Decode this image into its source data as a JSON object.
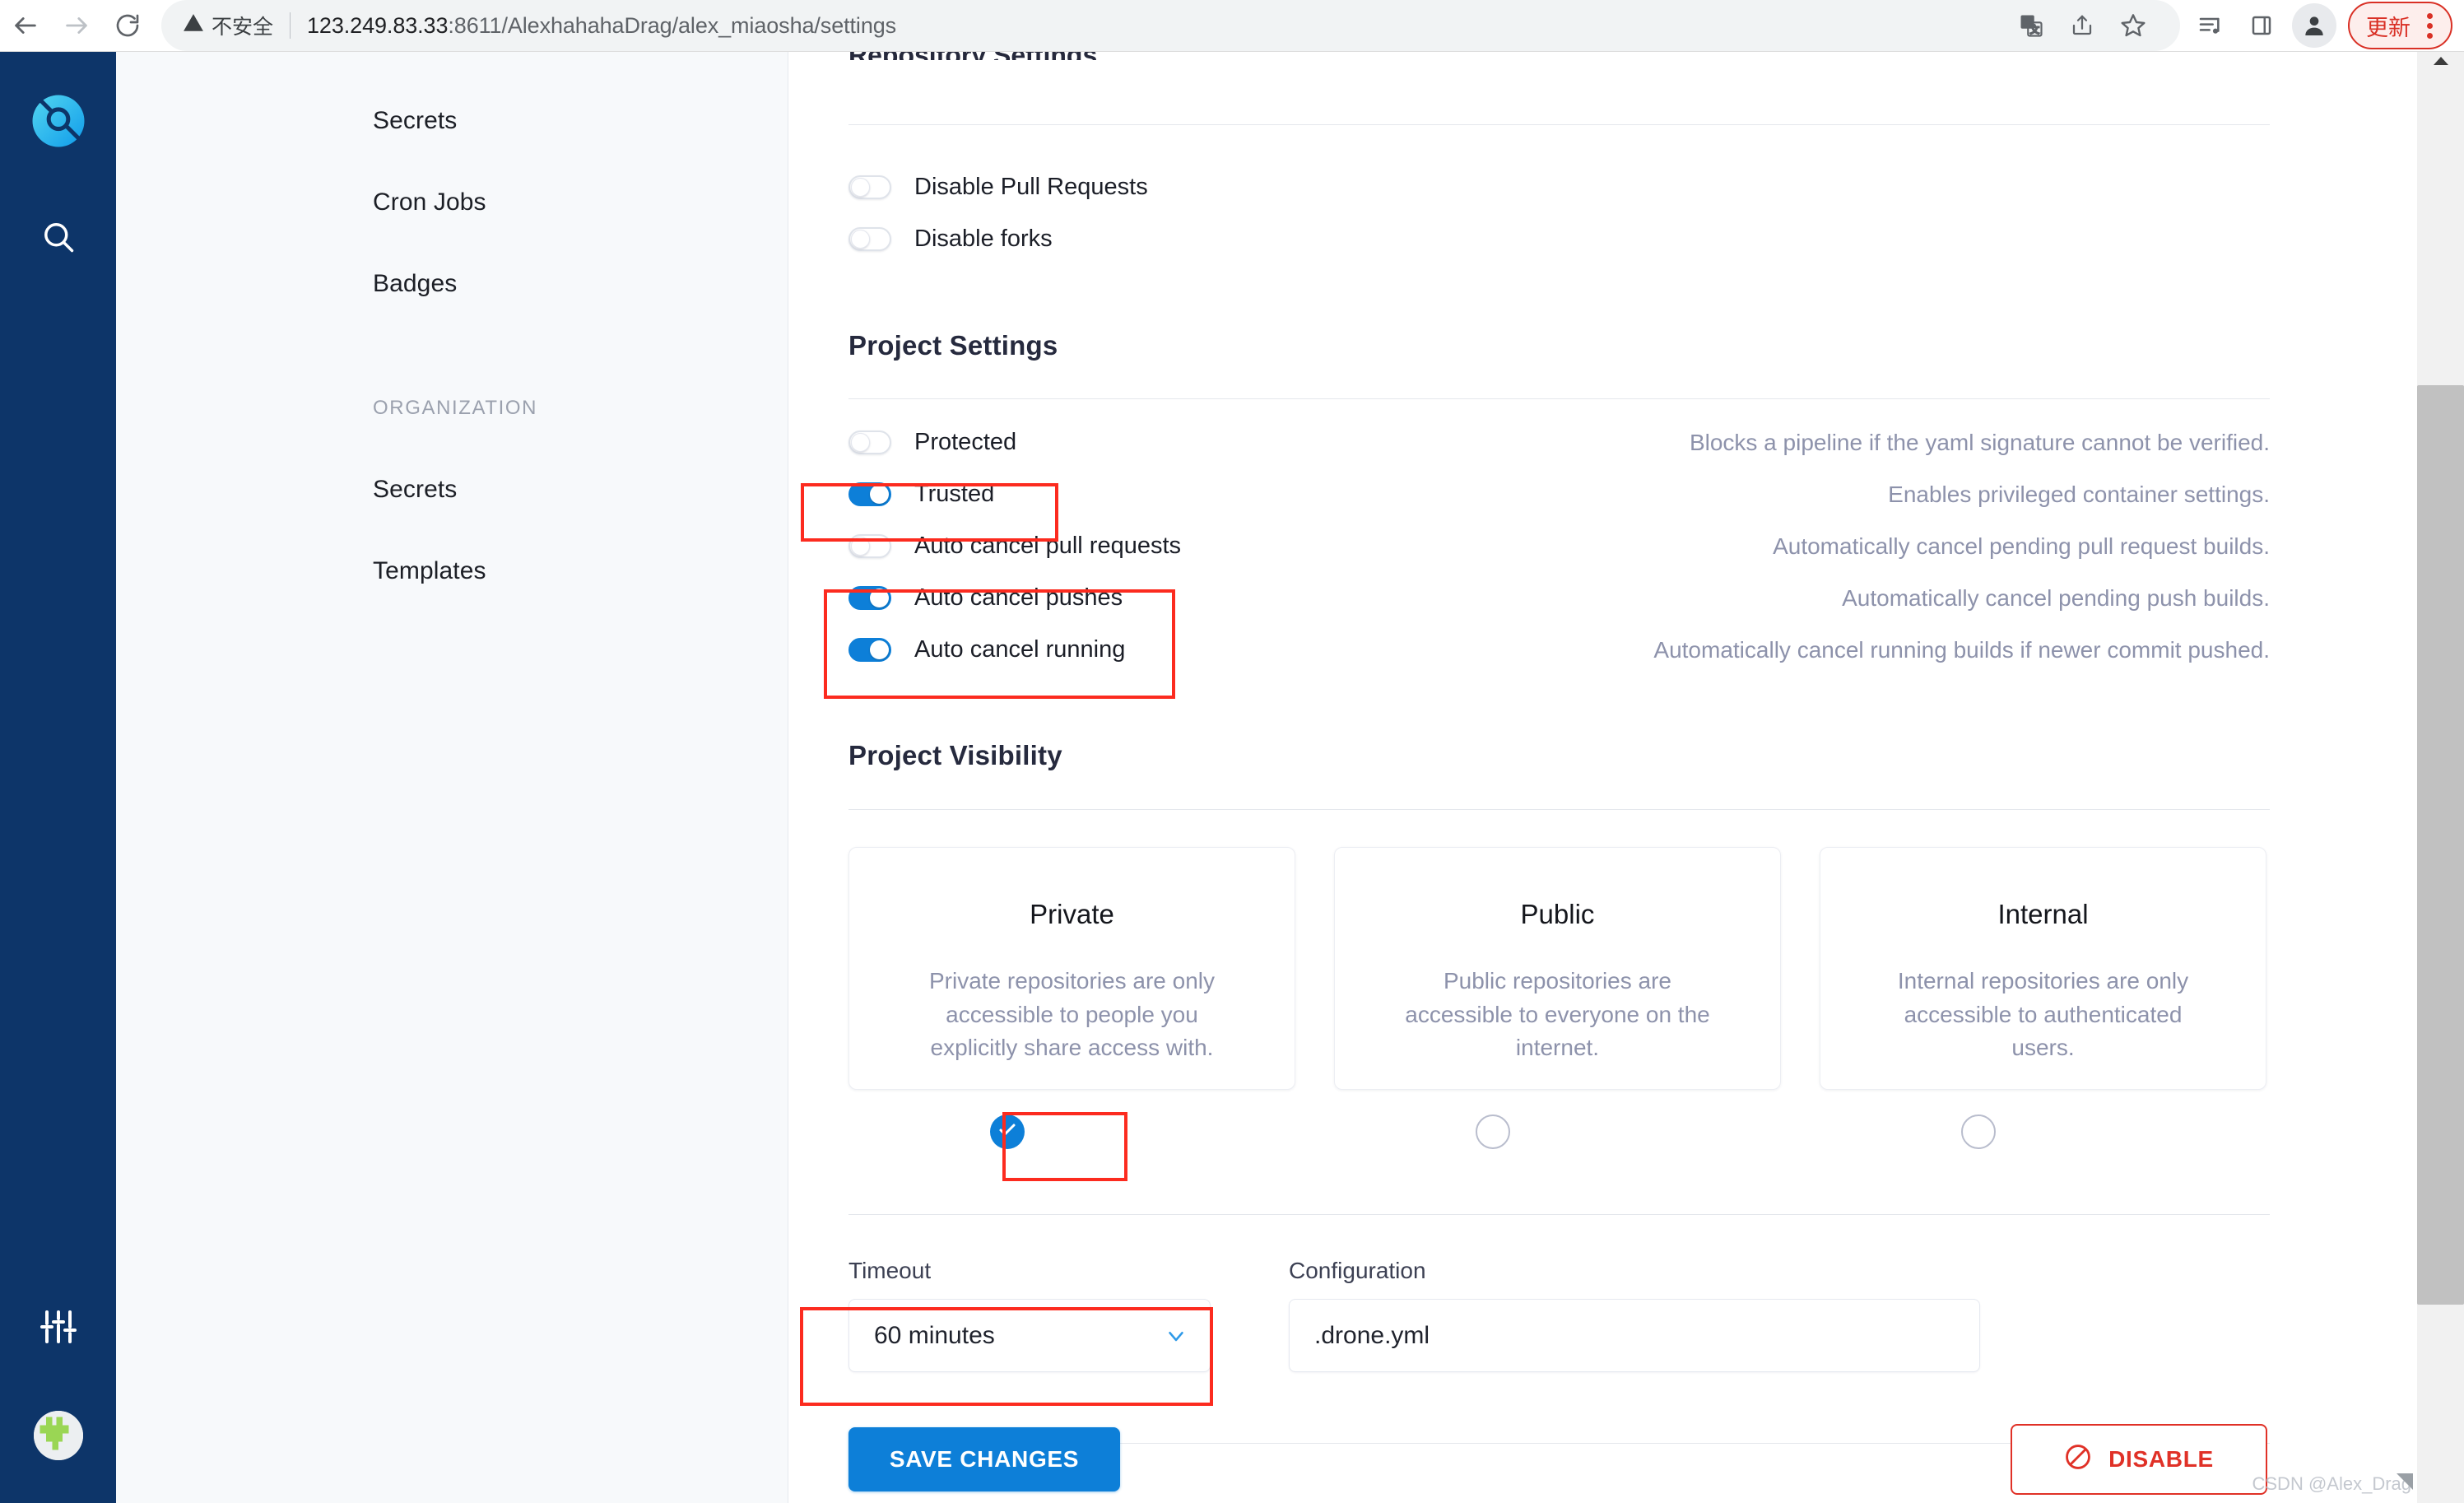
{
  "browser": {
    "back_icon": "back-arrow-icon",
    "forward_icon": "forward-arrow-icon",
    "reload_icon": "reload-icon",
    "security_icon": "warning-triangle-icon",
    "security_label": "不安全",
    "url_host": "123.249.83.33",
    "url_rest": ":8611/AlexhahahaDrag/alex_miaosha/settings",
    "actions": [
      {
        "name": "translate-icon"
      },
      {
        "name": "share-icon"
      },
      {
        "name": "bookmark-star-icon"
      }
    ],
    "toolbar_right": [
      {
        "name": "media-playlist-icon"
      },
      {
        "name": "side-panel-icon"
      }
    ],
    "avatar_icon": "profile-avatar-icon",
    "update_label": "更新",
    "menu_icon": "kebab-menu-icon"
  },
  "rail": {
    "logo_icon": "drone-logo-icon",
    "search_icon": "search-icon",
    "sliders_icon": "sliders-settings-icon",
    "avatar_icon": "user-avatar-icon"
  },
  "nav": {
    "items": [
      {
        "label": "Secrets"
      },
      {
        "label": "Cron Jobs"
      },
      {
        "label": "Badges"
      }
    ],
    "section_label": "ORGANIZATION",
    "org_items": [
      {
        "label": "Secrets"
      },
      {
        "label": "Templates"
      }
    ]
  },
  "main": {
    "cut_heading": "Repository Settings",
    "repo_toggles": [
      {
        "label": "Disable Pull Requests",
        "on": false
      },
      {
        "label": "Disable forks",
        "on": false
      }
    ],
    "project_settings": {
      "title": "Project Settings",
      "toggles": [
        {
          "label": "Protected",
          "on": false,
          "desc": "Blocks a pipeline if the yaml signature cannot be verified."
        },
        {
          "label": "Trusted",
          "on": true,
          "desc": "Enables privileged container settings."
        },
        {
          "label": "Auto cancel pull requests",
          "on": false,
          "desc": "Automatically cancel pending pull request builds."
        },
        {
          "label": "Auto cancel pushes",
          "on": true,
          "desc": "Automatically cancel pending push builds."
        },
        {
          "label": "Auto cancel running",
          "on": true,
          "desc": "Automatically cancel running builds if newer commit pushed."
        }
      ]
    },
    "project_visibility": {
      "title": "Project Visibility",
      "options": [
        {
          "title": "Private",
          "desc": "Private repositories are only accessible to people you explicitly share access with.",
          "selected": true
        },
        {
          "title": "Public",
          "desc": "Public repositories are accessible to everyone on the internet.",
          "selected": false
        },
        {
          "title": "Internal",
          "desc": "Internal repositories are only accessible to authenticated users.",
          "selected": false
        }
      ],
      "check_icon": "check-icon"
    },
    "timeout": {
      "label": "Timeout",
      "value": "60 minutes",
      "chevron_icon": "chevron-down-icon"
    },
    "configuration": {
      "label": "Configuration",
      "value": ".drone.yml"
    },
    "save_label": "SAVE CHANGES",
    "disable_label": "DISABLE",
    "disable_icon": "no-entry-icon"
  },
  "scrollbar": {
    "up_arrow_icon": "scroll-up-arrow-icon"
  },
  "watermark": "CSDN @Alex_Drag",
  "colors": {
    "accent_blue": "#0d7fd8",
    "rail_navy": "#0d3569",
    "danger_red": "#e03127",
    "annotation_red": "#fc2b1f",
    "muted_text": "#8d92ab"
  }
}
